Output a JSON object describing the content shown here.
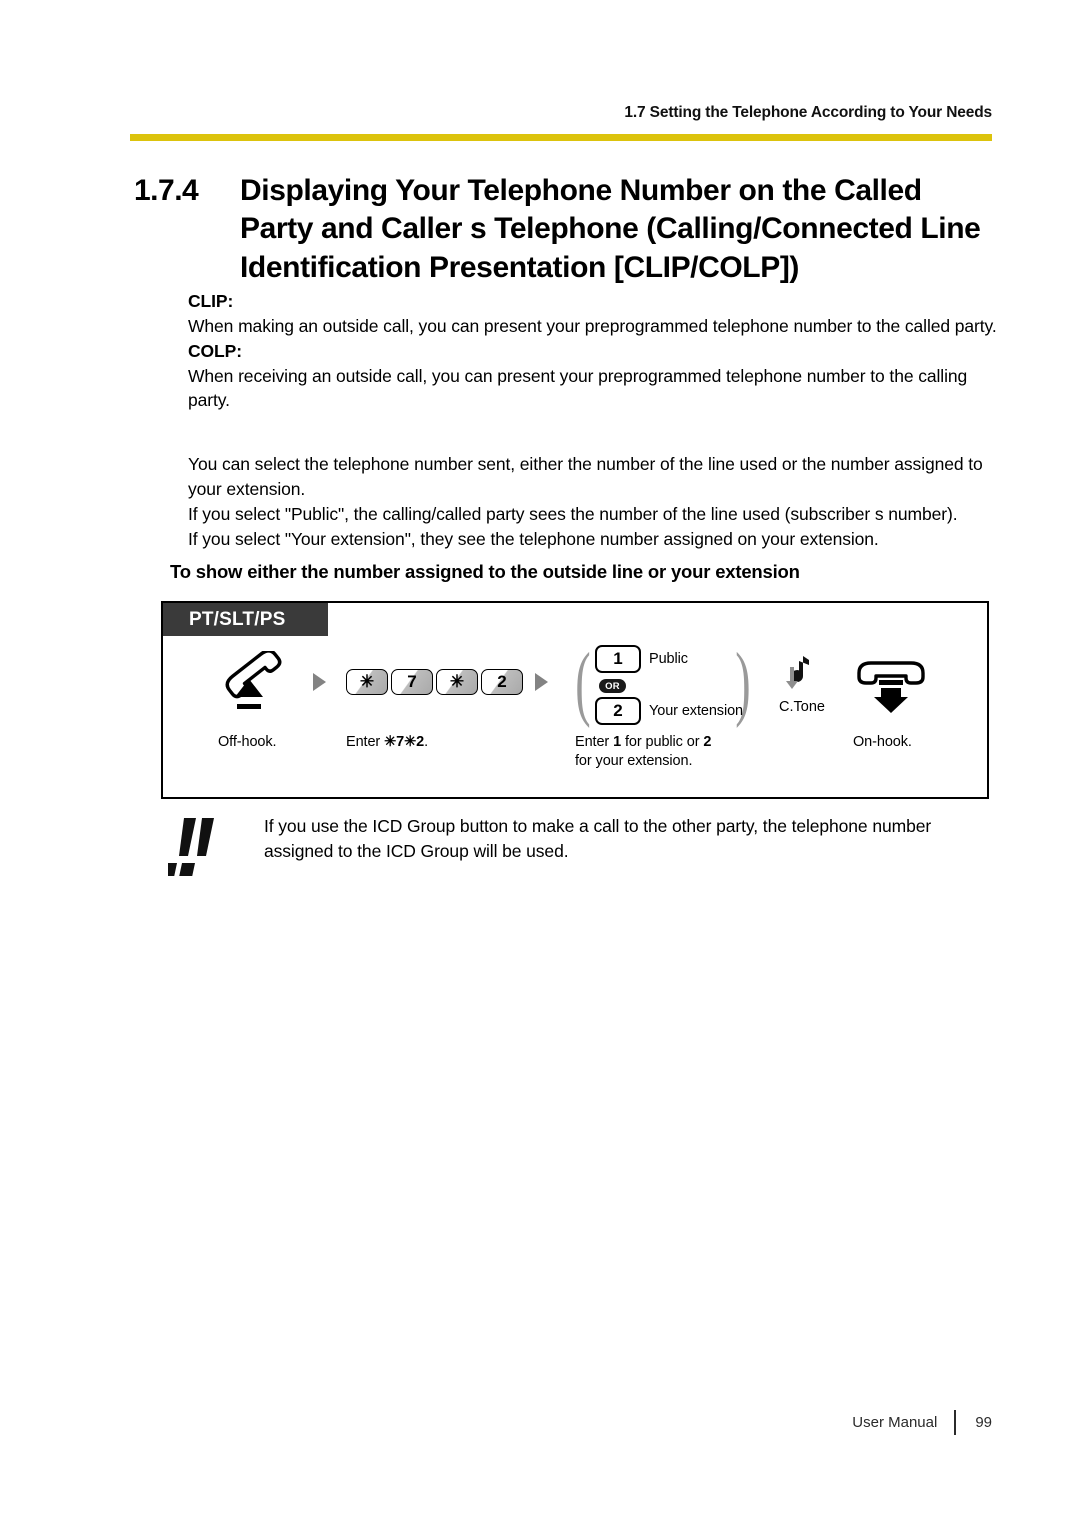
{
  "header": {
    "running_title": "1.7 Setting the Telephone According to Your Needs",
    "rule_color": "#dcc30c"
  },
  "section": {
    "number": "1.7.4",
    "title": "Displaying Your Telephone Number on the Called Party and Caller s Telephone (Calling/Connected Line Identification Presentation [CLIP/COLP])"
  },
  "body": {
    "clip_label": "CLIP:",
    "clip_text": "When making an outside call, you can present your preprogrammed telephone number to the called party.",
    "colp_label": "COLP:",
    "colp_text": "When receiving an outside call, you can present your preprogrammed telephone number to the calling party.",
    "para1": "You can select the telephone number sent, either the number of the line used or the number assigned to your extension.",
    "para2": "If you select \"Public\", the calling/called party sees the number of the line used (subscriber s number).",
    "para3": "If you select \"Your extension\", they see the telephone number assigned on your extension.",
    "subhead": "To show either the number assigned to the outside line or your extension"
  },
  "diagram": {
    "device_tab": "PT/SLT/PS",
    "steps": [
      {
        "icon": "handset-offhook-icon",
        "caption": "Off-hook."
      },
      {
        "icon": "keypad-keys",
        "keys": [
          "✳",
          "7",
          "✳",
          "2"
        ],
        "caption_prefix": "Enter ",
        "caption_code": "✳7✳2",
        "caption_suffix": "."
      },
      {
        "icon": "choice-group",
        "option1_key": "1",
        "option1_label": "Public",
        "or_label": "OR",
        "option2_key": "2",
        "option2_label": "Your extension",
        "caption_line1_a": "Enter ",
        "caption_line1_b": "1",
        "caption_line1_c": " for public or ",
        "caption_line1_d": "2",
        "caption_line2": "for your extension."
      },
      {
        "icon": "confirmation-tone-icon",
        "label": "C.Tone"
      },
      {
        "icon": "handset-onhook-icon",
        "caption": "On-hook."
      }
    ]
  },
  "note": {
    "icon": "double-exclamation-icon",
    "text": "If you use the ICD Group button to make a call to the other party, the telephone number assigned to the ICD Group will be used."
  },
  "footer": {
    "label": "User Manual",
    "page": "99"
  }
}
